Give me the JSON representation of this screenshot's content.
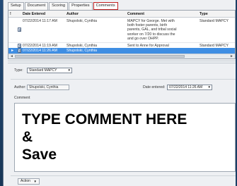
{
  "tabs": [
    {
      "label": "Setup"
    },
    {
      "label": "Document"
    },
    {
      "label": "Scoring"
    },
    {
      "label": "Properties"
    },
    {
      "label": "Comments"
    }
  ],
  "grid": {
    "columns": [
      "!",
      "Date Entered",
      "Author",
      "Comment",
      "Type"
    ],
    "rows": [
      {
        "date": "07/22/2014 11:17 AM",
        "author": "Shupolski, Cynthia",
        "comment": "MAPCY for George. Met with both foster parents, birth parents, GAL, and tribal social worker on 7/20 to discuss the and go over OHPP.",
        "type": "Standard MAPCY"
      },
      {
        "date": "07/22/2014 11:19 AM",
        "author": "Shupolski, Cynthia",
        "comment": "Sent to Anne for Approval",
        "type": "Standard MAPCY"
      },
      {
        "date": "07/22/2014 11:26 AM",
        "author": "Shupolski, Cynthia",
        "comment": "",
        "type": ""
      }
    ]
  },
  "form": {
    "type_label": "Type:",
    "type_value": "Standard MAPCY",
    "author_label": "Author:",
    "author_value": "Shupolski, Cynthia",
    "date_label": "Date entered:",
    "date_value": "07/22/2014 11:26 AM",
    "comment_label": "Comment",
    "comment_text": "TYPE COMMENT HERE\n&\nSave"
  },
  "action": {
    "label": "Action"
  }
}
